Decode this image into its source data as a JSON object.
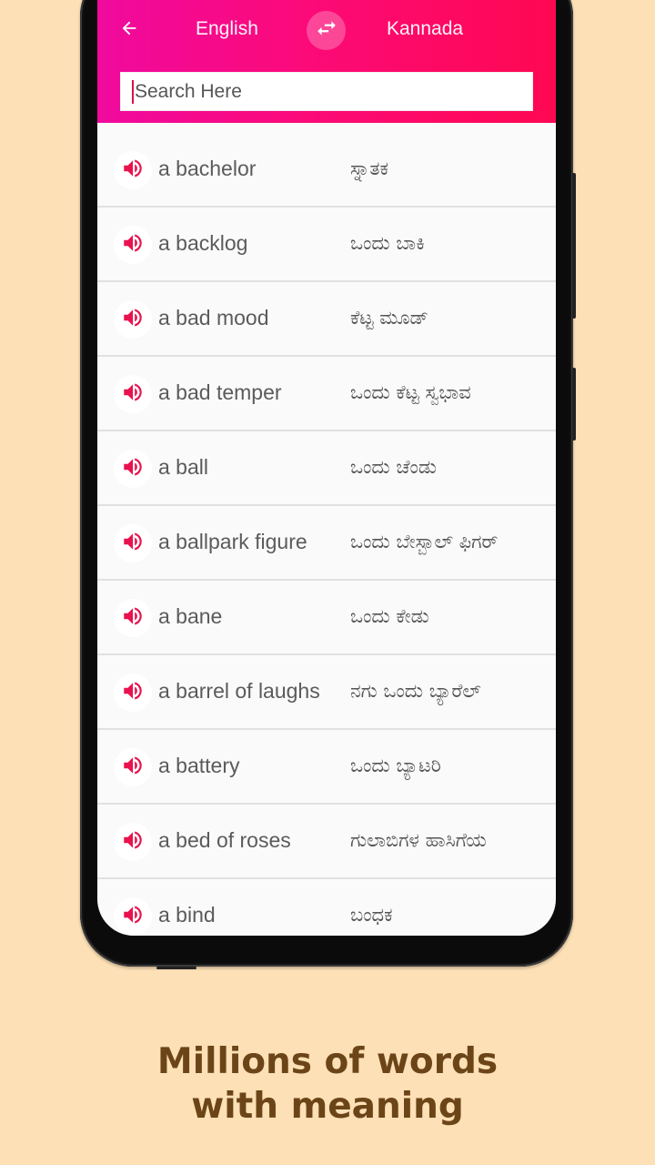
{
  "app": {
    "header": {
      "from_language": "English",
      "to_language": "Kannada",
      "back_icon": "arrow-left-icon",
      "swap_icon": "swap-arrows-icon"
    },
    "search": {
      "placeholder": "Search Here",
      "value": ""
    },
    "entries": [
      {
        "word": "a bachelor",
        "meaning": "ಸ್ನಾತಕ"
      },
      {
        "word": "a backlog",
        "meaning": "ಒಂದು ಬಾಕಿ"
      },
      {
        "word": "a bad mood",
        "meaning": "ಕೆಟ್ಟ ಮೂಡ್"
      },
      {
        "word": "a bad temper",
        "meaning": "ಒಂದು ಕೆಟ್ಟ ಸ್ವಭಾವ"
      },
      {
        "word": "a ball",
        "meaning": "ಒಂದು ಚೆಂಡು"
      },
      {
        "word": "a ballpark figure",
        "meaning": "ಒಂದು ಬೇಸ್ಬಾಲ್ ಫಿಗರ್"
      },
      {
        "word": "a bane",
        "meaning": "ಒಂದು ಕೇಡು"
      },
      {
        "word": "a barrel of laughs",
        "meaning": "ನಗು ಒಂದು ಬ್ಯಾರೆಲ್"
      },
      {
        "word": "a battery",
        "meaning": "ಒಂದು ಬ್ಯಾಟರಿ"
      },
      {
        "word": "a bed of roses",
        "meaning": "ಗುಲಾಬಿಗಳ ಹಾಸಿಗೆಯ"
      },
      {
        "word": "a bind",
        "meaning": "ಬಂಧಕ"
      }
    ],
    "speaker_icon": "speaker-volume-icon"
  },
  "promo": {
    "caption_line1": "Millions of words",
    "caption_line2": "with meaning"
  },
  "colors": {
    "gradient_start": "#f00a9e",
    "gradient_end": "#ff0852",
    "accent": "#e8124f",
    "background": "#fde0b6",
    "caption": "#6b4518"
  }
}
